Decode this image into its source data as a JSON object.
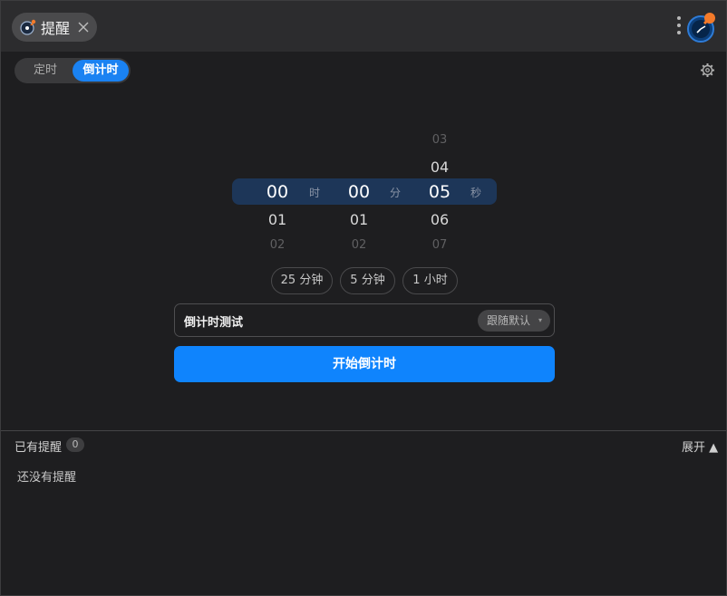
{
  "titlebar": {
    "tab_label": "提醒"
  },
  "mode": {
    "timer_label": "定时",
    "countdown_label": "倒计时"
  },
  "picker": {
    "hours": {
      "far_above": "",
      "above": "",
      "selected": "00",
      "below": "01",
      "far_below": "02",
      "unit": "时"
    },
    "minutes": {
      "far_above": "",
      "above": "",
      "selected": "00",
      "below": "01",
      "far_below": "02",
      "unit": "分"
    },
    "seconds": {
      "far_above": "03",
      "above": "04",
      "selected": "05",
      "below": "06",
      "far_below": "07",
      "unit": "秒"
    }
  },
  "presets": [
    "25 分钟",
    "5 分钟",
    "1 小时"
  ],
  "name_field": {
    "value": "倒计时测试"
  },
  "sound_select": {
    "value": "跟随默认"
  },
  "start_button": {
    "label": "开始倒计时"
  },
  "reminders": {
    "title": "已有提醒",
    "count": "0",
    "expand_label": "展开 ▲",
    "empty_message": "还没有提醒"
  },
  "colors": {
    "accent": "#0f84fd",
    "highlight_band": "#1d3658",
    "badge_orange": "#f47a2a"
  }
}
